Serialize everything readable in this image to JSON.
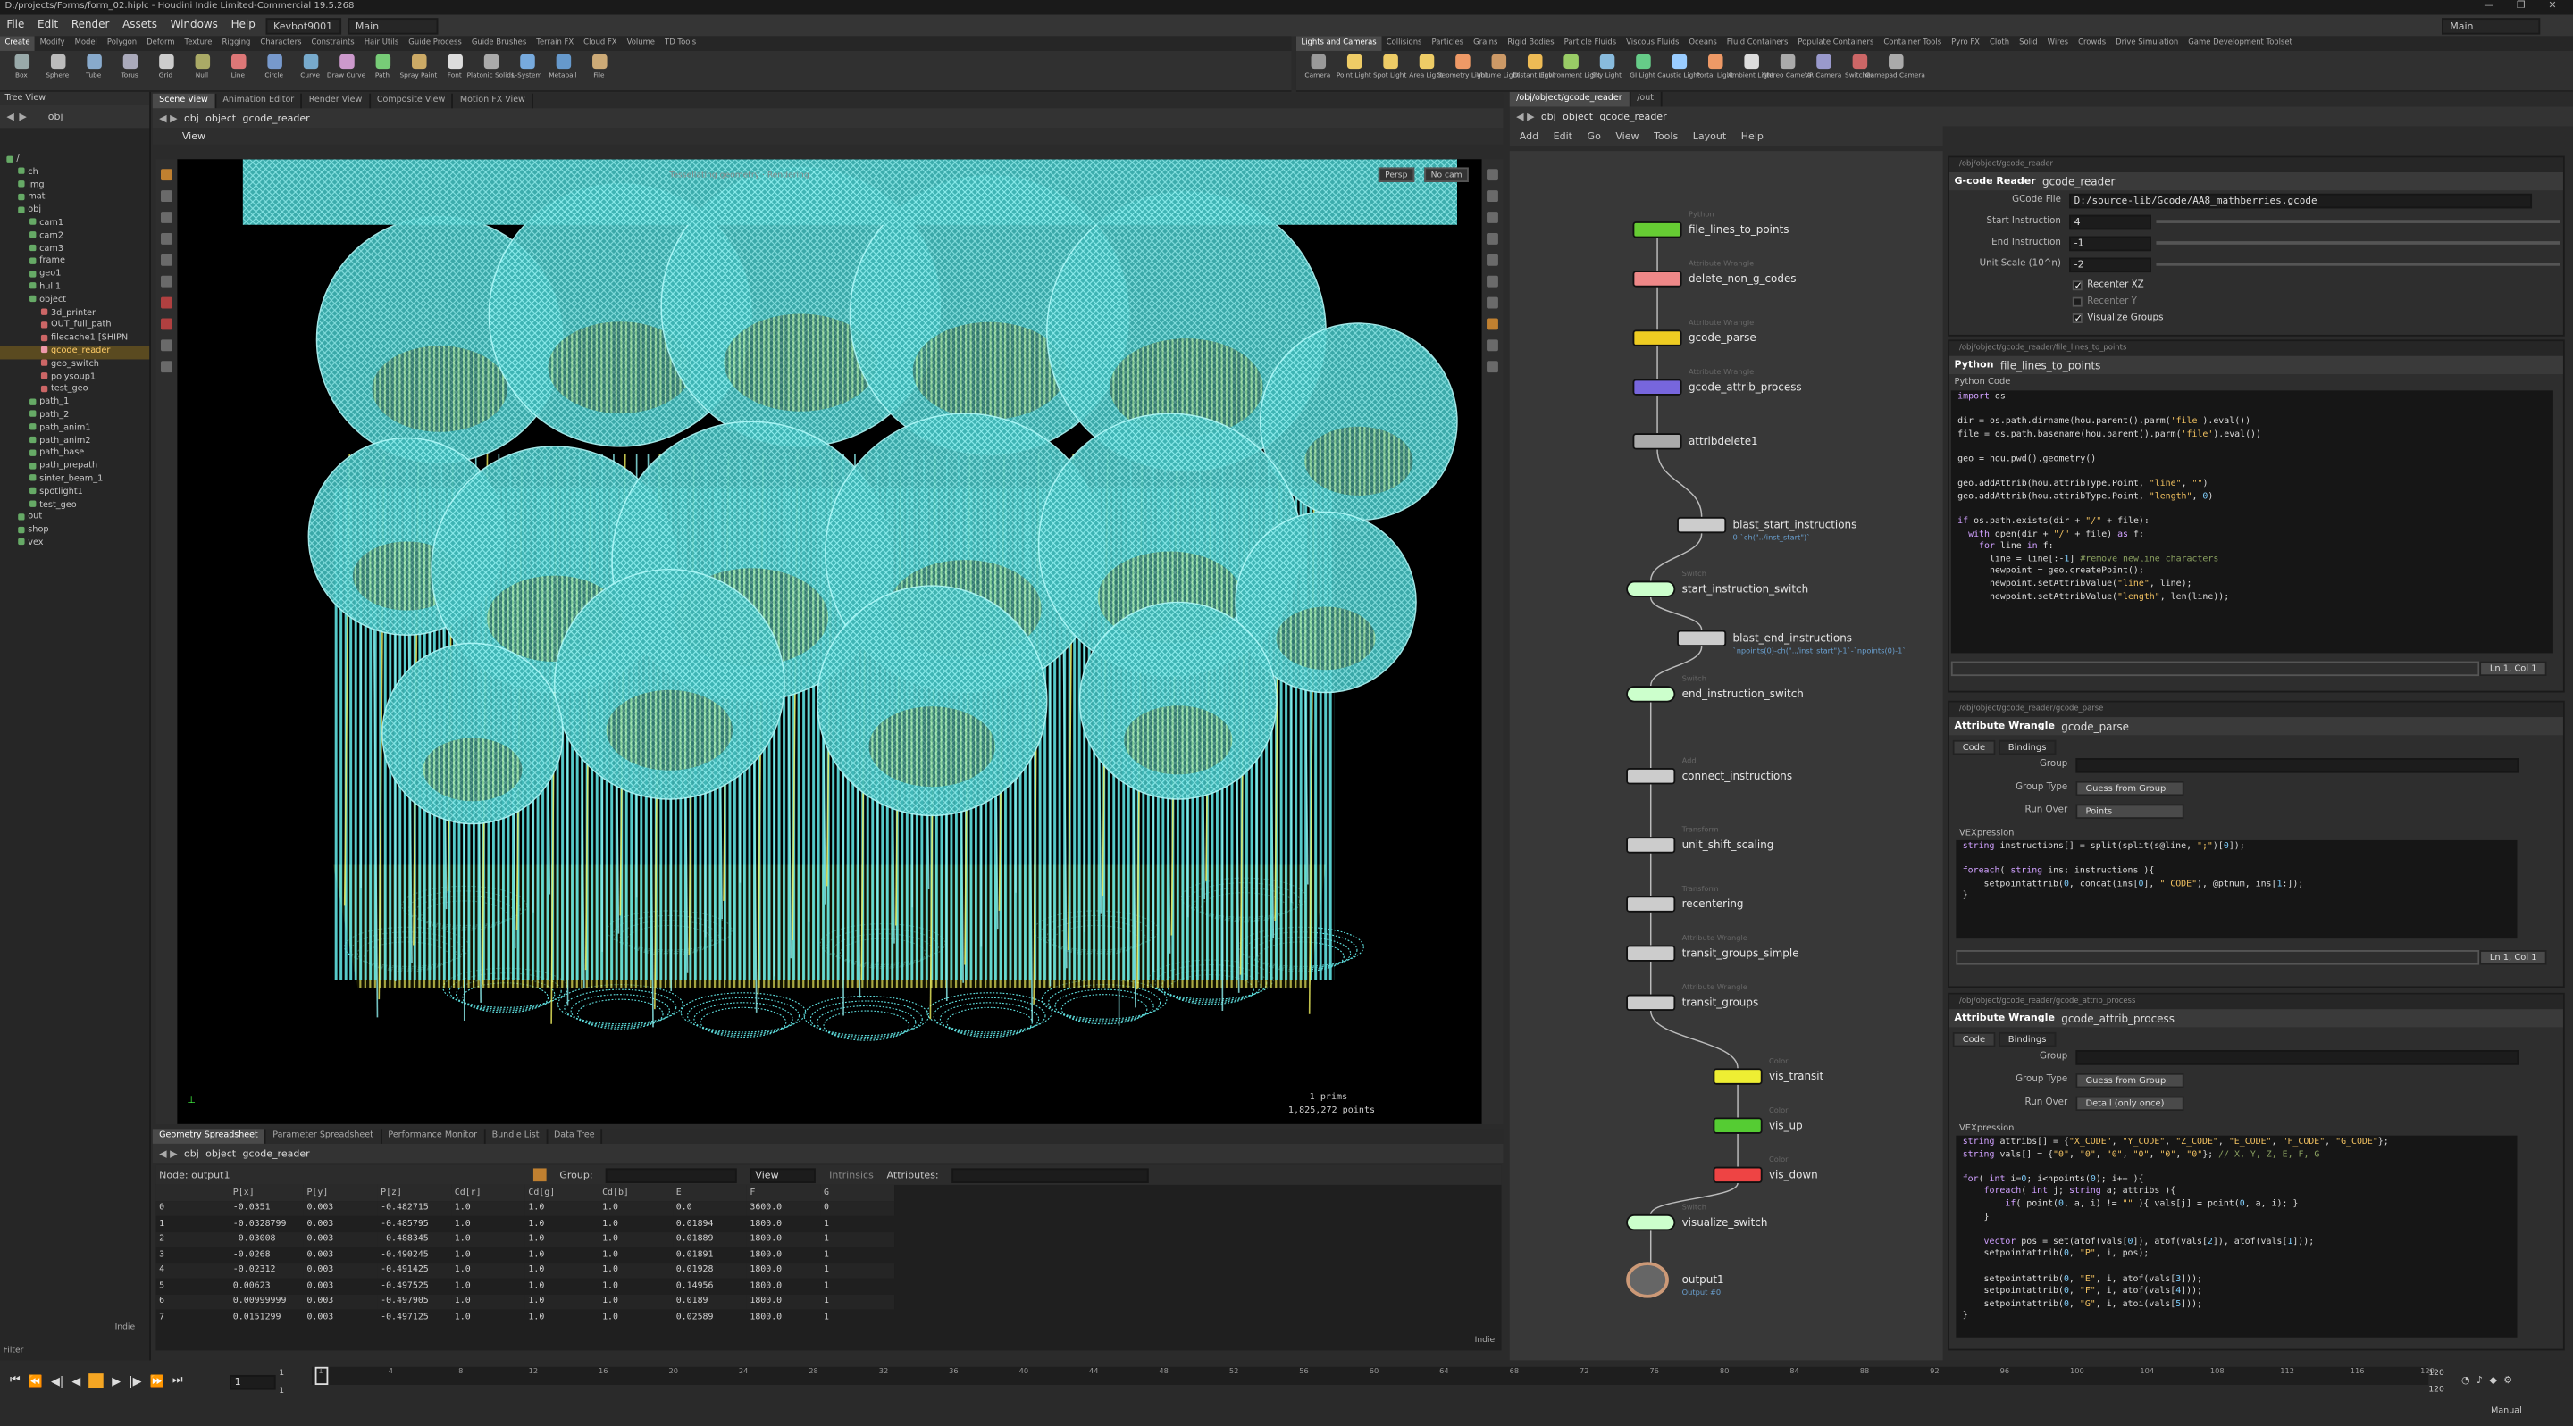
{
  "window_title": "D:/projects/Forms/form_02.hiplc - Houdini Indie Limited-Commercial 19.5.268",
  "menu": [
    "File",
    "Edit",
    "Render",
    "Assets",
    "Windows",
    "Help"
  ],
  "desktop": "Kevbot9001",
  "desk_main": "Main",
  "top_right_main": "Main",
  "shelf_tabs_left": [
    "Create",
    "Modify",
    "Model",
    "Polygon",
    "Deform",
    "Texture",
    "Rigging",
    "Characters",
    "Constraints",
    "Hair Utils",
    "Guide Process",
    "Guide Brushes",
    "Terrain FX",
    "Cloud FX",
    "Volume",
    "TD Tools"
  ],
  "shelf_tabs_right": [
    "Lights and Cameras",
    "Collisions",
    "Particles",
    "Grains",
    "Rigid Bodies",
    "Particle Fluids",
    "Viscous Fluids",
    "Oceans",
    "Fluid Containers",
    "Populate Containers",
    "Container Tools",
    "Pyro FX",
    "Cloth",
    "Solid",
    "Wires",
    "Crowds",
    "Drive Simulation",
    "Game Development Toolset"
  ],
  "tools_left": [
    "Box",
    "Sphere",
    "Tube",
    "Torus",
    "Grid",
    "Null",
    "Line",
    "Circle",
    "Curve",
    "Draw Curve",
    "Path",
    "Spray Paint",
    "Font",
    "Platonic Solids",
    "L-System",
    "Metaball",
    "File"
  ],
  "tools_right": [
    "Camera",
    "Point Light",
    "Spot Light",
    "Area Light",
    "Geometry Light",
    "Volume Light",
    "Distant Light",
    "Environment Light",
    "Sky Light",
    "GI Light",
    "Caustic Light",
    "Portal Light",
    "Ambient Light",
    "Stereo Camera",
    "VR Camera",
    "Switcher",
    "Gamepad Camera"
  ],
  "tree": {
    "title": "Tree View",
    "path": "obj",
    "filter_label": "Filter",
    "items": [
      {
        "t": "/",
        "d": 0
      },
      {
        "t": "ch",
        "d": 1
      },
      {
        "t": "img",
        "d": 1
      },
      {
        "t": "mat",
        "d": 1
      },
      {
        "t": "obj",
        "d": 1
      },
      {
        "t": "cam1",
        "d": 2
      },
      {
        "t": "cam2",
        "d": 2
      },
      {
        "t": "cam3",
        "d": 2
      },
      {
        "t": "frame",
        "d": 2
      },
      {
        "t": "geo1",
        "d": 2
      },
      {
        "t": "hull1",
        "d": 2
      },
      {
        "t": "object",
        "d": 2
      },
      {
        "t": "3d_printer",
        "d": 3
      },
      {
        "t": "OUT_full_path",
        "d": 3
      },
      {
        "t": "filecache1 [SHIPN",
        "d": 3
      },
      {
        "t": "gcode_reader",
        "d": 3,
        "sel": true
      },
      {
        "t": "geo_switch",
        "d": 3
      },
      {
        "t": "polysoup1",
        "d": 3
      },
      {
        "t": "test_geo",
        "d": 3
      },
      {
        "t": "path_1",
        "d": 2
      },
      {
        "t": "path_2",
        "d": 2
      },
      {
        "t": "path_anim1",
        "d": 2
      },
      {
        "t": "path_anim2",
        "d": 2
      },
      {
        "t": "path_base",
        "d": 2
      },
      {
        "t": "path_prepath",
        "d": 2
      },
      {
        "t": "sinter_beam_1",
        "d": 2
      },
      {
        "t": "spotlight1",
        "d": 2
      },
      {
        "t": "test_geo",
        "d": 2
      },
      {
        "t": "out",
        "d": 1
      },
      {
        "t": "shop",
        "d": 1
      },
      {
        "t": "vex",
        "d": 1
      }
    ],
    "footer": "Indie"
  },
  "viewer": {
    "tabs": [
      "Scene View",
      "Animation Editor",
      "Render View",
      "Composite View",
      "Motion FX View"
    ],
    "path": [
      "obj",
      "object",
      "gcode_reader"
    ],
    "view_label": "View",
    "persp": "Persp",
    "cam": "No cam",
    "info_top": "Tessellating geometry · Rendering",
    "stats": [
      "1 prims",
      "1,825,272 points"
    ]
  },
  "spreadsheet": {
    "tabs": [
      "Geometry Spreadsheet",
      "Parameter Spreadsheet",
      "Performance Monitor",
      "Bundle List",
      "Data Tree"
    ],
    "path": [
      "obj",
      "object",
      "gcode_reader"
    ],
    "node_label": "Node: output1",
    "group_label": "Group:",
    "view_label": "View",
    "intrinsics": "Intrinsics",
    "attributes": "Attributes:",
    "footer": "Indie",
    "columns": [
      "",
      "P[x]",
      "P[y]",
      "P[z]",
      "Cd[r]",
      "Cd[g]",
      "Cd[b]",
      "E",
      "F",
      "G"
    ],
    "rows": [
      [
        "0",
        "-0.0351",
        "0.003",
        "-0.482715",
        "1.0",
        "1.0",
        "1.0",
        "0.0",
        "3600.0",
        "0"
      ],
      [
        "1",
        "-0.0328799",
        "0.003",
        "-0.485795",
        "1.0",
        "1.0",
        "1.0",
        "0.01894",
        "1800.0",
        "1"
      ],
      [
        "2",
        "-0.03008",
        "0.003",
        "-0.488345",
        "1.0",
        "1.0",
        "1.0",
        "0.01889",
        "1800.0",
        "1"
      ],
      [
        "3",
        "-0.0268",
        "0.003",
        "-0.490245",
        "1.0",
        "1.0",
        "1.0",
        "0.01891",
        "1800.0",
        "1"
      ],
      [
        "4",
        "-0.02312",
        "0.003",
        "-0.491425",
        "1.0",
        "1.0",
        "1.0",
        "0.01928",
        "1800.0",
        "1"
      ],
      [
        "5",
        "0.00623",
        "0.003",
        "-0.497525",
        "1.0",
        "1.0",
        "1.0",
        "0.14956",
        "1800.0",
        "1"
      ],
      [
        "6",
        "0.00999999",
        "0.003",
        "-0.497905",
        "1.0",
        "1.0",
        "1.0",
        "0.0189",
        "1800.0",
        "1"
      ],
      [
        "7",
        "0.0151299",
        "0.003",
        "-0.497125",
        "1.0",
        "1.0",
        "1.0",
        "0.02589",
        "1800.0",
        "1"
      ]
    ]
  },
  "network": {
    "tabs": [
      "/obj/object/gcode_reader",
      "/out"
    ],
    "path": [
      "obj",
      "object",
      "gcode_reader"
    ],
    "menu": [
      "Add",
      "Edit",
      "Go",
      "View",
      "Tools",
      "Layout",
      "Help"
    ],
    "nodes": [
      {
        "typ": "Python",
        "lbl": "file_lines_to_points"
      },
      {
        "typ": "Attribute Wrangle",
        "lbl": "delete_non_g_codes"
      },
      {
        "typ": "Attribute Wrangle",
        "lbl": "gcode_parse"
      },
      {
        "typ": "Attribute Wrangle",
        "lbl": "gcode_attrib_process"
      },
      {
        "typ": "",
        "lbl": "attribdelete1"
      },
      {
        "typ": "",
        "lbl": "blast_start_instructions",
        "sub": "0-`ch(\"../inst_start\")`"
      },
      {
        "typ": "Switch",
        "lbl": "start_instruction_switch"
      },
      {
        "typ": "",
        "lbl": "blast_end_instructions",
        "sub": "`npoints(0)-ch(\"../inst_start\")-1`-`npoints(0)-1`"
      },
      {
        "typ": "Switch",
        "lbl": "end_instruction_switch"
      },
      {
        "typ": "Add",
        "lbl": "connect_instructions"
      },
      {
        "typ": "Transform",
        "lbl": "unit_shift_scaling"
      },
      {
        "typ": "Transform",
        "lbl": "recentering"
      },
      {
        "typ": "Attribute Wrangle",
        "lbl": "transit_groups_simple"
      },
      {
        "typ": "Attribute Wrangle",
        "lbl": "transit_groups"
      },
      {
        "typ": "Color",
        "lbl": "vis_transit"
      },
      {
        "typ": "Color",
        "lbl": "vis_up"
      },
      {
        "typ": "Color",
        "lbl": "vis_down"
      },
      {
        "typ": "Switch",
        "lbl": "visualize_switch"
      },
      {
        "typ": "",
        "lbl": "output1",
        "sub": "Output #0"
      }
    ]
  },
  "p1": {
    "path": "/obj/object/gcode_reader",
    "type": "G-code Reader",
    "name": "gcode_reader",
    "file_label": "GCode File",
    "file": "D:/source-lib/Gcode/AA8_mathberries.gcode",
    "start_label": "Start Instruction",
    "start": "4",
    "end_label": "End Instruction",
    "end": "-1",
    "unit_label": "Unit Scale (10^n)",
    "unit": "-2",
    "recenter_xz": "Recenter XZ",
    "recenter_y": "Recenter Y",
    "vis_groups": "Visualize Groups"
  },
  "p2": {
    "path": "/obj/object/gcode_reader/file_lines_to_points",
    "type": "Python",
    "name": "file_lines_to_points",
    "section": "Python Code",
    "status": "Ln 1, Col 1"
  },
  "p3": {
    "path": "/obj/object/gcode_reader/gcode_parse",
    "type": "Attribute Wrangle",
    "name": "gcode_parse",
    "tabs": [
      "Code",
      "Bindings"
    ],
    "group": "Group",
    "group_type": "Group Type",
    "group_type_v": "Guess from Group",
    "run_over": "Run Over",
    "run_over_v": "Points",
    "vex": "VEXpression",
    "status": "Ln 1, Col 1"
  },
  "p4": {
    "path": "/obj/object/gcode_reader/gcode_attrib_process",
    "type": "Attribute Wrangle",
    "name": "gcode_attrib_process",
    "tabs": [
      "Code",
      "Bindings"
    ],
    "group": "Group",
    "group_type": "Group Type",
    "group_type_v": "Guess from Group",
    "run_over": "Run Over",
    "run_over_v": "Detail (only once)",
    "vex": "VEXpression"
  },
  "timeline": {
    "frame": "1",
    "start": "1",
    "end": "120",
    "end2": "120",
    "mode": "Manual",
    "ticks": [
      "1",
      "4",
      "8",
      "12",
      "16",
      "20",
      "24",
      "28",
      "32",
      "36",
      "40",
      "44",
      "48",
      "52",
      "56",
      "60",
      "64",
      "68",
      "72",
      "76",
      "80",
      "84",
      "88",
      "92",
      "96",
      "100",
      "104",
      "108",
      "112",
      "116",
      "120"
    ]
  },
  "colors": {
    "accent": "#f5a623",
    "wire": "#5fe0e0",
    "infill": "#f0f060"
  }
}
